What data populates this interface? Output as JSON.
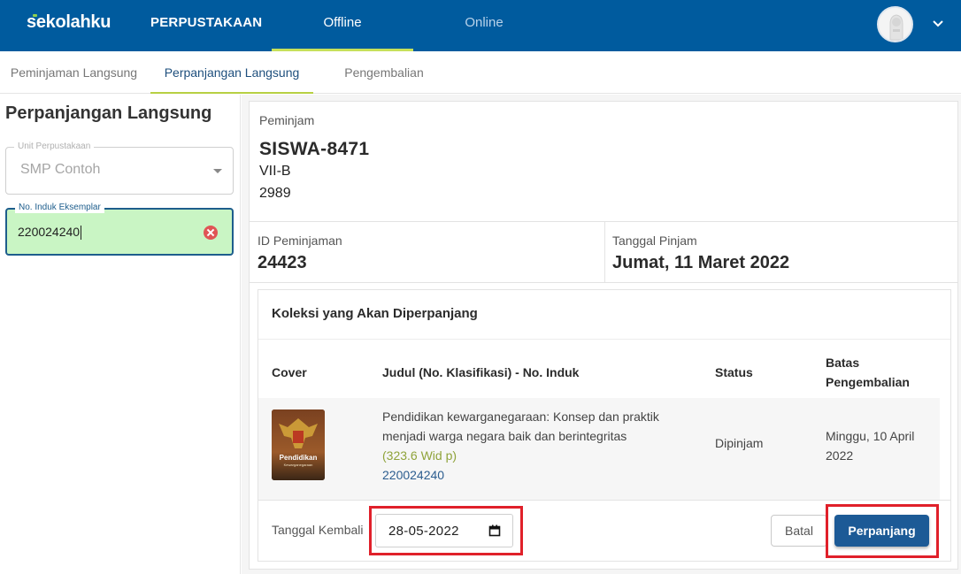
{
  "topbar": {
    "logo": "sekolahku",
    "app_title": "PERPUSTAKAAN",
    "tabs": [
      {
        "label": "Offline",
        "active": true
      },
      {
        "label": "Online",
        "active": false
      }
    ],
    "bg_color": "#005b9e",
    "accent_color": "#c6e05a"
  },
  "subtabs": [
    {
      "label": "Peminjaman Langsung",
      "active": false
    },
    {
      "label": "Perpanjangan Langsung",
      "active": true
    },
    {
      "label": "Pengembalian",
      "active": false
    }
  ],
  "left_panel": {
    "title": "Perpanjangan Langsung",
    "unit_field": {
      "label": "Unit Perpustakaan",
      "value": "SMP Contoh"
    },
    "no_induk_field": {
      "label": "No. Induk Eksemplar",
      "value": "220024240"
    }
  },
  "borrower": {
    "label": "Peminjam",
    "name": "SISWA-8471",
    "class": "VII-B",
    "number": "2989"
  },
  "loan": {
    "id_label": "ID Peminjaman",
    "id_value": "24423",
    "date_label": "Tanggal Pinjam",
    "date_value": "Jumat, 11 Maret 2022"
  },
  "collection": {
    "title": "Koleksi yang Akan Diperpanjang",
    "headers": {
      "cover": "Cover",
      "judul": "Judul (No. Klasifikasi) - No. Induk",
      "status": "Status",
      "batas": "Batas Pengembalian"
    },
    "rows": [
      {
        "cover_text": "Pendidikan",
        "cover_subtext": "Kewarganegaraan",
        "title": "Pendidikan kewarganegaraan: Konsep dan praktik menjadi warga negara baik dan berintegritas",
        "classification": "(323.6 Wid p)",
        "no_induk": "220024240",
        "status": "Dipinjam",
        "due_date": "Minggu, 10 April 2022"
      }
    ]
  },
  "footer": {
    "return_label": "Tanggal Kembali",
    "return_date": "28-05-2022",
    "cancel_label": "Batal",
    "extend_label": "Perpanjang",
    "extend_color": "#1c5a96",
    "highlight_color": "#e0202a"
  }
}
